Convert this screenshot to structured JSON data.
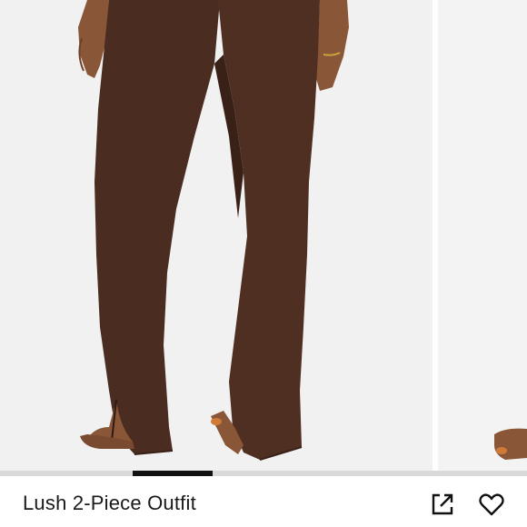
{
  "product": {
    "title": "Lush 2-Piece Outfit"
  },
  "carousel": {
    "image_alt": "Brown flared leggings with side slit, back view",
    "current_slide": 2,
    "indicator_position": 0.33
  },
  "actions": {
    "share_icon": "share-external-icon",
    "like_icon": "heart-outline-icon"
  },
  "colors": {
    "background": "#f1f1f1",
    "fabric": "#4a2c20",
    "skin": "#8a5638",
    "text": "#1a1a1a"
  }
}
